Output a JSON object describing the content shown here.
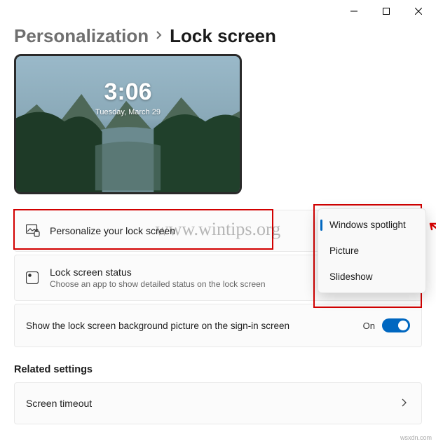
{
  "titlebar": {
    "minimize": "Minimize",
    "maximize": "Maximize",
    "close": "Close"
  },
  "breadcrumb": {
    "parent": "Personalization",
    "current": "Lock screen"
  },
  "preview": {
    "time": "3:06",
    "date": "Tuesday, March 29"
  },
  "watermark": "www.wintips.org",
  "source": "wsxdn.com",
  "cards": {
    "personalize": {
      "title": "Personalize your lock screen"
    },
    "status": {
      "title": "Lock screen status",
      "subtitle": "Choose an app to show detailed status on the lock screen"
    },
    "signin": {
      "title": "Show the lock screen background picture on the sign-in screen",
      "toggle_label": "On"
    },
    "timeout": {
      "title": "Screen timeout"
    }
  },
  "dropdown": {
    "opt1": "Windows spotlight",
    "opt2": "Picture",
    "opt3": "Slideshow"
  },
  "sections": {
    "related": "Related settings"
  }
}
